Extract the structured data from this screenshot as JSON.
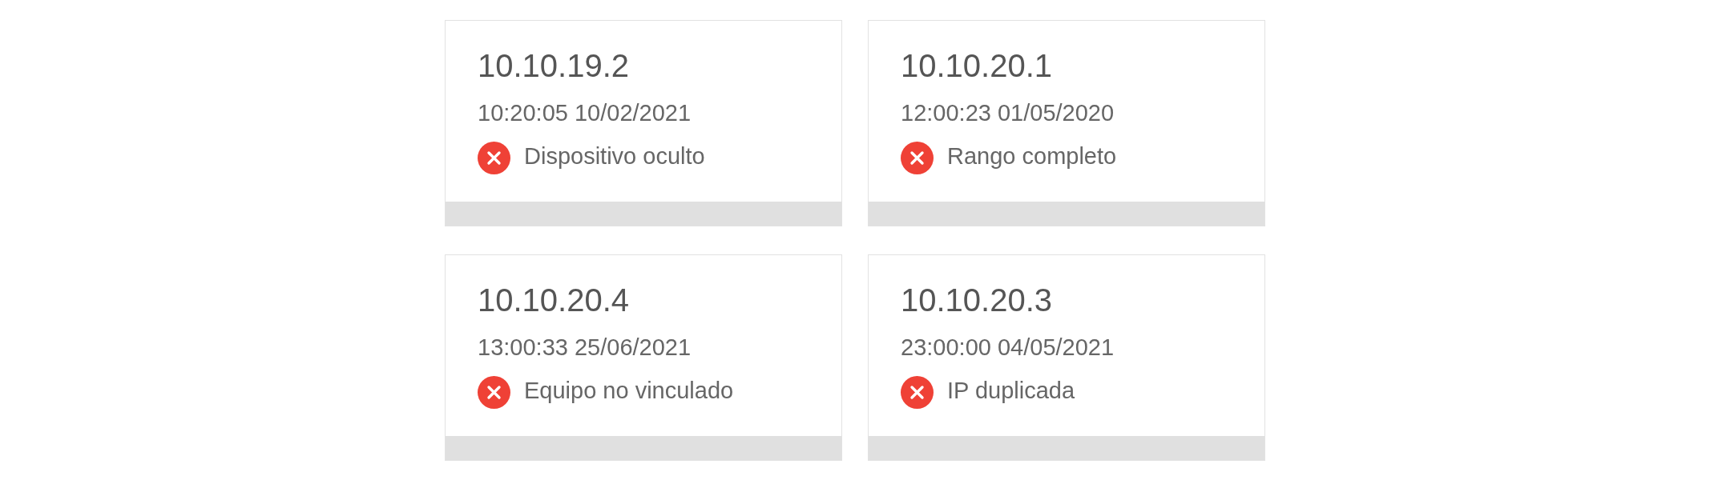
{
  "cards": [
    {
      "ip": "10.10.19.2",
      "timestamp": "10:20:05 10/02/2021",
      "status": {
        "kind": "error",
        "text": "Dispositivo oculto"
      }
    },
    {
      "ip": "10.10.20.1",
      "timestamp": "12:00:23 01/05/2020",
      "status": {
        "kind": "error",
        "text": "Rango completo"
      }
    },
    {
      "ip": "10.10.20.4",
      "timestamp": "13:00:33 25/06/2021",
      "status": {
        "kind": "error",
        "text": "Equipo no vinculado"
      }
    },
    {
      "ip": "10.10.20.3",
      "timestamp": "23:00:00 04/05/2021",
      "status": {
        "kind": "error",
        "text": "IP duplicada"
      }
    }
  ]
}
